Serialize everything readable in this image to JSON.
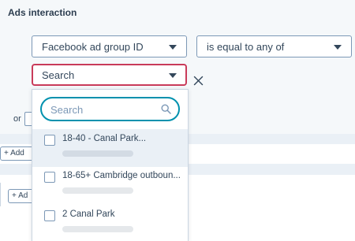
{
  "section": {
    "title": "Ads interaction"
  },
  "filter": {
    "field_value": "Facebook ad group ID",
    "operator_value": "is equal to any of",
    "value_select_label": "Search"
  },
  "or_label": "or",
  "add_buttons": [
    "+ Add",
    "+ Ad"
  ],
  "dropdown": {
    "search_placeholder": "Search",
    "options": [
      {
        "label": "18-40 - Canal Park...",
        "checked": false
      },
      {
        "label": "18-65+ Cambridge outboun...",
        "checked": false
      },
      {
        "label": "2 Canal Park",
        "checked": false
      }
    ]
  },
  "colors": {
    "accent_focus": "#0091ae",
    "error_border": "#c93b5a",
    "panel_bg": "#f5f8fa",
    "text": "#33475b"
  }
}
